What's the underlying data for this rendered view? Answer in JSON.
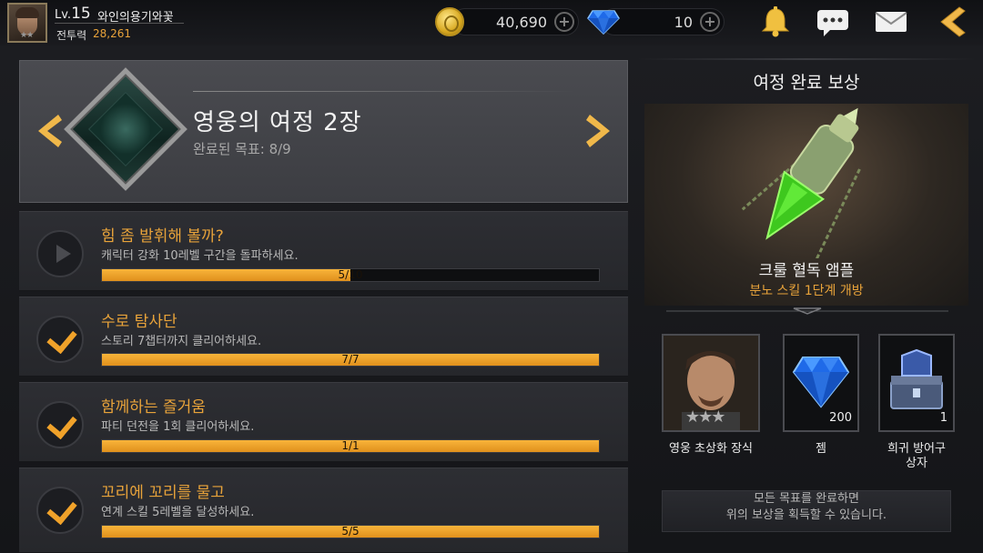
{
  "player": {
    "level_prefix": "Lv.",
    "level": "15",
    "nickname": "와인의용기와꽃",
    "power_label": "전투력",
    "power_value": "28,261"
  },
  "currency": {
    "gold": "40,690",
    "gems": "10",
    "plus_symbol": "+"
  },
  "header_icons": [
    "bell-icon",
    "chat-icon",
    "mail-icon",
    "back-arrow-icon"
  ],
  "chapter": {
    "title": "영웅의 여정 2장",
    "progress_text": "완료된 목표: 8/9"
  },
  "missions": [
    {
      "title": "힘 좀 발휘해 볼까?",
      "desc": "캐릭터 강화 10레벨 구간을 돌파하세요.",
      "progress": "5/10",
      "fraction": 0.5,
      "status": "in-progress"
    },
    {
      "title": "수로 탐사단",
      "desc": "스토리 7챕터까지 클리어하세요.",
      "progress": "7/7",
      "fraction": 1.0,
      "status": "done"
    },
    {
      "title": "함께하는 즐거움",
      "desc": "파티 던전을 1회 클리어하세요.",
      "progress": "1/1",
      "fraction": 1.0,
      "status": "done"
    },
    {
      "title": "꼬리에 꼬리를 물고",
      "desc": "연계 스킬 5레벨을 달성하세요.",
      "progress": "5/5",
      "fraction": 1.0,
      "status": "done"
    }
  ],
  "reward_panel": {
    "title": "여정 완료 보상",
    "main_reward_name": "크룰 혈독 앰플",
    "main_reward_effect": "분노 스킬 1단계 개방",
    "items": [
      {
        "label": "영웅 초상화 장식",
        "count": "",
        "stars": 3
      },
      {
        "label": "젬",
        "count": "200"
      },
      {
        "label_line1": "희귀 방어구",
        "label_line2": "상자",
        "count": "1"
      }
    ],
    "notice_line1": "모든 목표를 완료하면",
    "notice_line2": "위의 보상을 획득할 수 있습니다."
  },
  "colors": {
    "accent_orange": "#e8a33a",
    "gem_blue": "#2a7aff",
    "toxin_green": "#6adc3a"
  }
}
